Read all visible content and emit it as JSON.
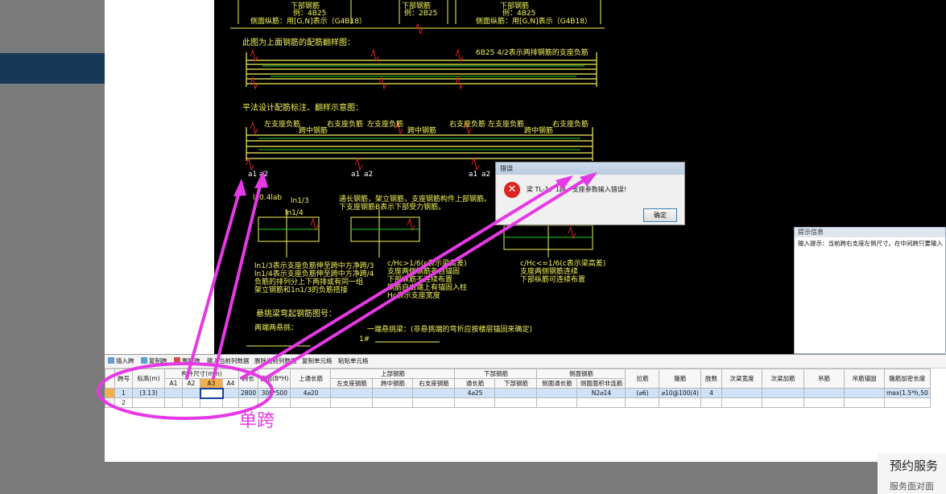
{
  "cad": {
    "top_labels": [
      {
        "text": "下部钢筋",
        "sub": "例：4B25"
      },
      {
        "text": "下部钢筋",
        "sub": "例：2B25"
      },
      {
        "text": "下部钢筋",
        "sub": "例：4B25"
      }
    ],
    "side_note_left": "侧面纵筋：用[G,N]表示（G4B18）",
    "side_note_right": "侧面纵筋：用[G,N]表示（G4B18）",
    "heading1": "此图为上面钢筋的配筋翻样图：",
    "note_6b25": "6B25 4/2表示两排钢筋的支座负筋",
    "heading2": "平法设计配筋标注、翻样示意图：",
    "labels_row": [
      "左支座负筋",
      "跨中钢筋",
      "右支座负筋",
      "左支座负筋",
      "跨中钢筋",
      "右支座负筋",
      "左支座负筋",
      "跨中钢筋",
      "右支座负筋"
    ],
    "anchor_labels": [
      "a1",
      "a2",
      "a1",
      "a2",
      "a1",
      "a2"
    ],
    "anchor_note": "la0.4lab",
    "ln3": "ln1/3",
    "ln4": "ln1/4",
    "mid_note1": "通长钢筋，架立钢筋，支座钢筋构件上部钢筋。",
    "mid_note2": "下支座钢筋B表示下部受力钢筋。",
    "left_notes": [
      "ln1/3表示支座负筋伸至跨中方净跨/3",
      "ln1/4表示支座负筋伸至跨中方净跨/4",
      "负筋的排列分上下两排或有同一组",
      "架立钢筋和1n1/3的负筋搭接"
    ],
    "center_notes": [
      "c/Hc>1/6(c表示梁高差)",
      "支座两侧钢筋各自锚固",
      "下部纵筋不连续布置",
      "钢筋自由端上有锚固入柱",
      "Hc表示支座宽度"
    ],
    "right_notes": [
      "c/Hc<=1/6(c表示梁高差)",
      "支座两侧钢筋连续",
      "下部纵筋可连续布置"
    ],
    "cant_heading": "悬挑梁弯起钢筋图号：",
    "cant_sub": "两端两悬挑：",
    "cant_sub2": "一端悬挑梁：(非悬挑端的弯折应按楼层锚固来确定)",
    "cant_no": "1#"
  },
  "dialog": {
    "title": "错误",
    "message": "梁 TL-1，1跨，支座参数输入错误!",
    "ok_label": "确定"
  },
  "hint": {
    "title": "提示信息",
    "text": "输入提示：当前跨右支座左侧尺寸。在中间跨只要输入"
  },
  "toolbar": {
    "items": [
      "插入跨",
      "复制跨",
      "删除跨",
      "输入当前列数据",
      "删除当前列数据",
      "复制单元格",
      "粘贴单元格"
    ]
  },
  "grid": {
    "group_headers": {
      "size": "构件尺寸(mm)",
      "top": "上部钢筋",
      "bottom": "下部钢筋",
      "side": "侧面钢筋"
    },
    "columns": [
      "跨号",
      "标高(m)",
      "A1",
      "A2",
      "A3",
      "A4",
      "跨长",
      "截面(B*H)",
      "上通长筋",
      "左支座钢筋",
      "跨中钢筋",
      "右支座钢筋",
      "通长筋",
      "下部钢筋",
      "侧面通长筋",
      "侧面面积非连筋",
      "拉筋",
      "箍筋",
      "肢数",
      "次梁宽度",
      "次梁加筋",
      "吊筋",
      "吊筋锚固",
      "箍筋加密长度"
    ],
    "rows": [
      [
        "1",
        "(3.13)",
        "",
        "",
        "",
        "",
        "2800",
        "300*500",
        "4⌀20",
        "",
        "",
        "",
        "4⌀25",
        "",
        "",
        "N2⌀14",
        "(⌀6)",
        "⌀10@100(4)",
        "4",
        "",
        "",
        "",
        "",
        "max(1.5*h,50"
      ],
      [
        "2",
        "",
        "",
        "",
        "",
        "",
        "",
        "",
        "",
        "",
        "",
        "",
        "",
        "",
        "",
        "",
        "",
        "",
        "",
        "",
        "",
        "",
        "",
        ""
      ]
    ]
  },
  "annotation": {
    "label": "单跨"
  },
  "background_text": {
    "title": "预约服务",
    "sub": "服务面对面"
  },
  "colors": {
    "cad_bg": "#000000",
    "cad_yellow": "#f3f35a",
    "cad_red": "#e02020",
    "cad_green": "#20d020",
    "annot_magenta": "#e639e6"
  }
}
